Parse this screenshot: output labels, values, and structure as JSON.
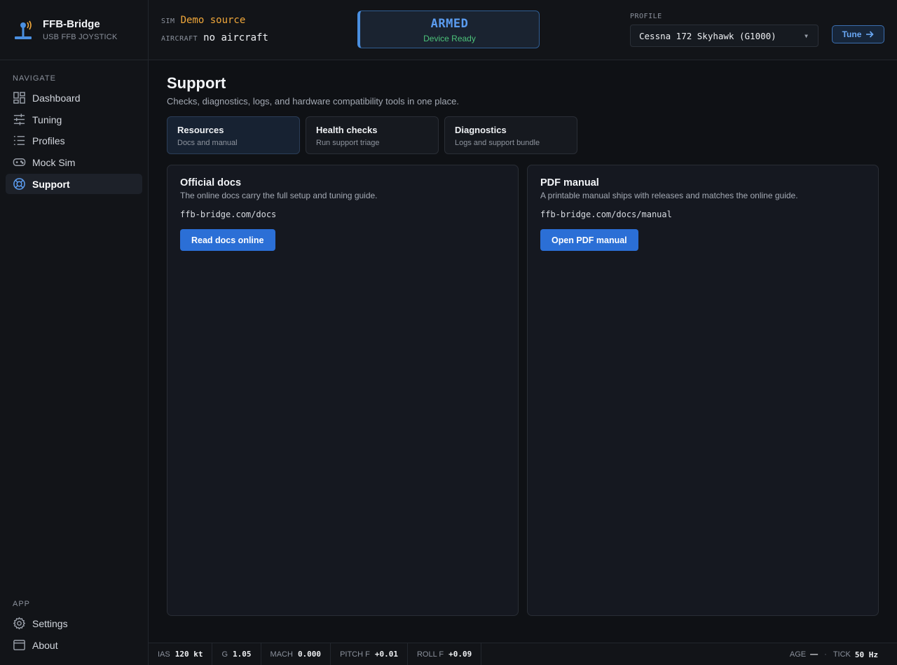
{
  "brand": {
    "name": "FFB-Bridge",
    "subtitle": "USB FFB JOYSTICK"
  },
  "nav": {
    "section_label": "NAVIGATE",
    "items": [
      {
        "label": "Dashboard",
        "icon": "dashboard-icon"
      },
      {
        "label": "Tuning",
        "icon": "sliders-icon"
      },
      {
        "label": "Profiles",
        "icon": "list-icon"
      },
      {
        "label": "Mock Sim",
        "icon": "gamepad-icon"
      },
      {
        "label": "Support",
        "icon": "lifebuoy-icon",
        "active": true
      }
    ],
    "app_label": "APP",
    "app_items": [
      {
        "label": "Settings",
        "icon": "gear-icon"
      },
      {
        "label": "About",
        "icon": "window-icon"
      }
    ]
  },
  "header": {
    "sim_label": "SIM",
    "sim_value": "Demo source",
    "aircraft_label": "AIRCRAFT",
    "aircraft_value": "no aircraft",
    "status_state": "ARMED",
    "status_sub": "Device Ready",
    "profile_label": "PROFILE",
    "profile_value": "Cessna 172 Skyhawk (G1000)",
    "tune_label": "Tune"
  },
  "page": {
    "title": "Support",
    "subtitle": "Checks, diagnostics, logs, and hardware compatibility tools in one place.",
    "tabs": [
      {
        "title": "Resources",
        "sub": "Docs and manual",
        "active": true
      },
      {
        "title": "Health checks",
        "sub": "Run support triage"
      },
      {
        "title": "Diagnostics",
        "sub": "Logs and support bundle"
      }
    ],
    "cards": [
      {
        "title": "Official docs",
        "desc": "The online docs carry the full setup and tuning guide.",
        "url": "ffb-bridge.com/docs",
        "button": "Read docs online"
      },
      {
        "title": "PDF manual",
        "desc": "A printable manual ships with releases and matches the online guide.",
        "url": "ffb-bridge.com/docs/manual",
        "button": "Open PDF manual"
      }
    ]
  },
  "footer": {
    "stats": [
      {
        "k": "IAS",
        "v": "120 kt"
      },
      {
        "k": "G",
        "v": "1.05"
      },
      {
        "k": "MACH",
        "v": "0.000"
      },
      {
        "k": "PITCH F",
        "v": "+0.01"
      },
      {
        "k": "ROLL F",
        "v": "+0.09"
      }
    ],
    "age_label": "AGE",
    "age_value": "—",
    "separator": "·",
    "tick_label": "TICK",
    "tick_value": "50 Hz"
  },
  "colors": {
    "accent": "#2b6fd6",
    "sim_value": "#f0a73a",
    "armed": "#5b9cf0",
    "ready": "#4cc27a"
  }
}
